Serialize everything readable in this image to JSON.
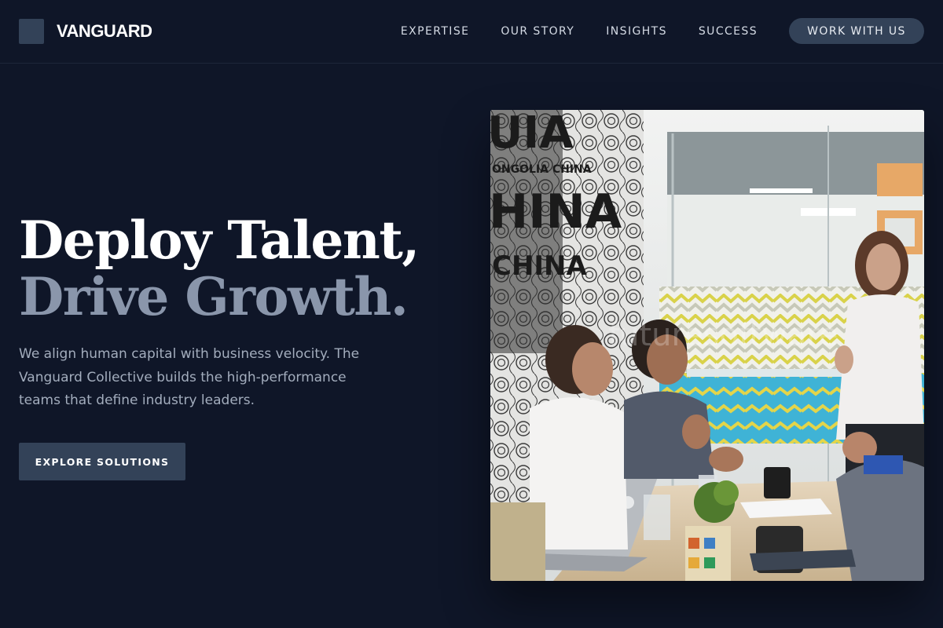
{
  "header": {
    "brand": "VANGUARD",
    "nav": [
      "EXPERTISE",
      "OUR STORY",
      "INSIGHTS",
      "SUCCESS"
    ],
    "cta": "WORK WITH US"
  },
  "hero": {
    "title_line1": "Deploy Talent,",
    "title_line2": "Drive Growth.",
    "description": "We align human capital with business velocity. The Vanguard Collective builds the high-performance teams that define industry leaders.",
    "button": "EXPLORE SOLUTIONS"
  },
  "colors": {
    "background": "#0f1628",
    "accent": "#334258",
    "muted_title": "#8a96ab",
    "body_text": "#a3adbd"
  }
}
